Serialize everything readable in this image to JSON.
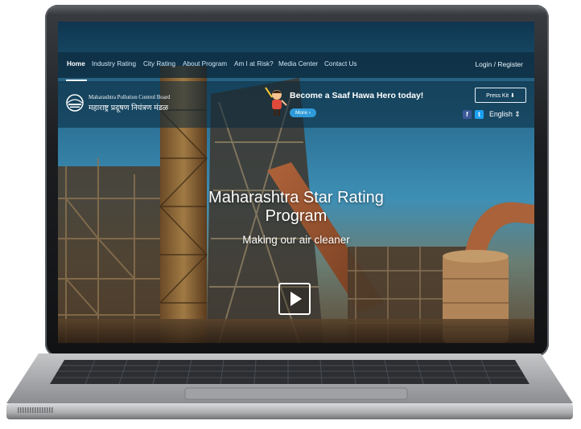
{
  "nav": {
    "items": [
      "Home",
      "Industry Rating",
      "City Rating",
      "About Program",
      "Am I at Risk?",
      "Media Center",
      "Contact Us"
    ],
    "login": "Login / Register"
  },
  "org": {
    "name_en": "Maharashtra Pollution Control Board",
    "name_mr": "महाराष्ट्र प्रदूषण नियंत्रण मंडळ"
  },
  "promo": {
    "title": "Become a Saaf Hawa Hero today!",
    "more": "More ›"
  },
  "header_right": {
    "press_kit": "Press Kit ⬇",
    "facebook": "f",
    "twitter": "t",
    "language": "English ⇕"
  },
  "hero": {
    "title": "Maharashtra Star Rating Program",
    "subtitle": "Making our air cleaner"
  },
  "icons": [
    "logo-icon",
    "mascot-icon",
    "facebook-icon",
    "twitter-icon",
    "play-icon",
    "download-icon"
  ],
  "colors": {
    "more_button": "#2e9ad8",
    "facebook": "#3b5998",
    "twitter": "#1da1f2"
  }
}
